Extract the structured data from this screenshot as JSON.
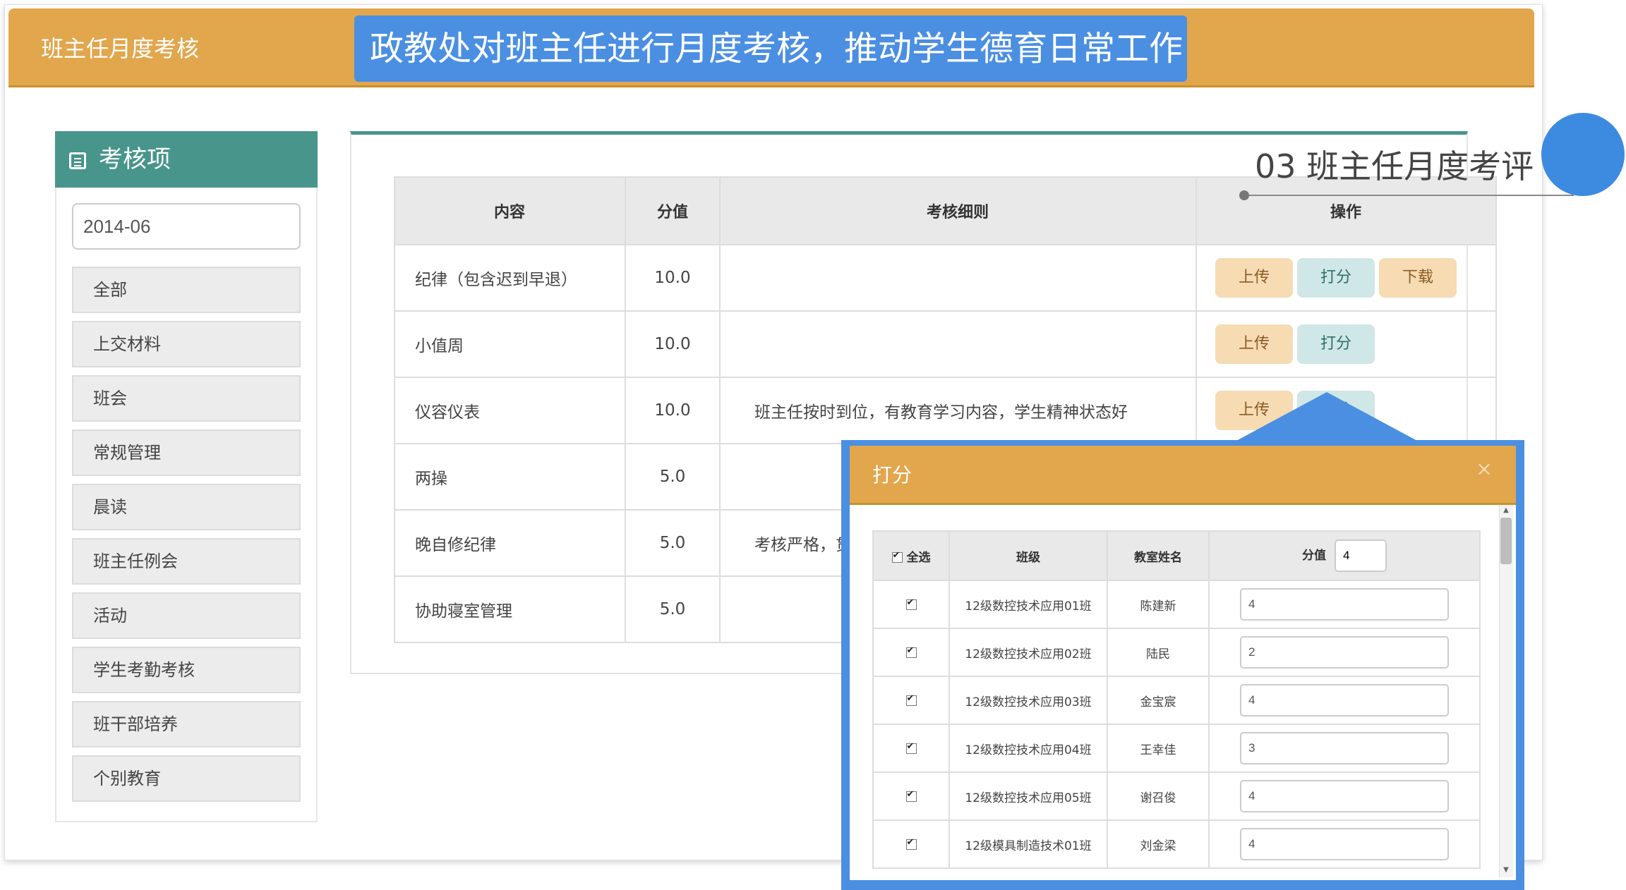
{
  "app": {
    "title": "班主任月度考核",
    "banner": "政教处对班主任进行月度考核，推动学生德育日常工作"
  },
  "annotation": {
    "text": "03 班主任月度考评"
  },
  "sidebar": {
    "heading": "考核项",
    "month": "2014-06",
    "items": [
      "全部",
      "上交材料",
      "班会",
      "常规管理",
      "晨读",
      "班主任例会",
      "活动",
      "学生考勤考核",
      "班干部培养",
      "个别教育"
    ]
  },
  "main_table": {
    "headers": [
      "内容",
      "分值",
      "考核细则",
      "操作"
    ],
    "rows": [
      {
        "content": "纪律（包含迟到早退）",
        "score": "10.0",
        "rule": "",
        "actions": [
          "上传",
          "打分",
          "下载"
        ]
      },
      {
        "content": "小值周",
        "score": "10.0",
        "rule": "",
        "actions": [
          "上传",
          "打分"
        ]
      },
      {
        "content": "仪容仪表",
        "score": "10.0",
        "rule": "班主任按时到位，有教育学习内容，学生精神状态好",
        "actions": [
          "上传",
          "打分"
        ]
      },
      {
        "content": "两操",
        "score": "5.0",
        "rule": "",
        "actions": []
      },
      {
        "content": "晚自修纪律",
        "score": "5.0",
        "rule": "考核严格，贯彻",
        "actions": []
      },
      {
        "content": "协助寝室管理",
        "score": "5.0",
        "rule": "",
        "actions": []
      }
    ]
  },
  "dialog": {
    "title": "打分",
    "close": "×",
    "headers": {
      "select_all": "全选",
      "class": "班级",
      "teacher": "教室姓名",
      "score": "分值"
    },
    "header_score_value": "4",
    "rows": [
      {
        "class": "12级数控技术应用01班",
        "teacher": "陈建新",
        "score": "4"
      },
      {
        "class": "12级数控技术应用02班",
        "teacher": "陆民",
        "score": "2"
      },
      {
        "class": "12级数控技术应用03班",
        "teacher": "金宝宸",
        "score": "4"
      },
      {
        "class": "12级数控技术应用04班",
        "teacher": "王幸佳",
        "score": "3"
      },
      {
        "class": "12级数控技术应用05班",
        "teacher": "谢召俊",
        "score": "4"
      },
      {
        "class": "12级模具制造技术01班",
        "teacher": "刘金梁",
        "score": "4"
      }
    ]
  },
  "colors": {
    "header_orange": "#e2a64c",
    "banner_blue": "#4a8fe2",
    "teal": "#48958c"
  }
}
